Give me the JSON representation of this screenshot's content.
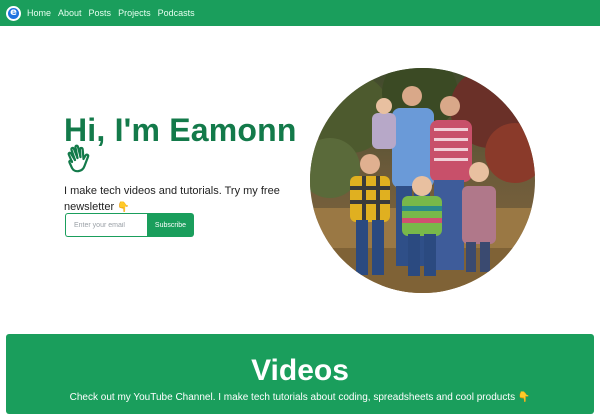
{
  "navbar": {
    "brand_letter": "e",
    "links": [
      "Home",
      "About",
      "Posts",
      "Projects",
      "Podcasts"
    ]
  },
  "hero": {
    "title": "Hi, I'm Eamonn",
    "wave_icon": "waving-hand-icon",
    "description": "I make tech videos and tutorials. Try my free newsletter",
    "description_emoji": "👇",
    "email_placeholder": "Enter your email",
    "subscribe_label": "Subscribe"
  },
  "photo": {
    "alt": "family-photo"
  },
  "videos": {
    "title": "Videos",
    "subtitle": "Check out my YouTube Channel. I make tech tutorials about coding, spreadsheets and cool products",
    "subtitle_emoji": "👇"
  },
  "colors": {
    "brand_green": "#1a9e5c",
    "title_green": "#137a4a",
    "logo_blue": "#1f73e0"
  }
}
